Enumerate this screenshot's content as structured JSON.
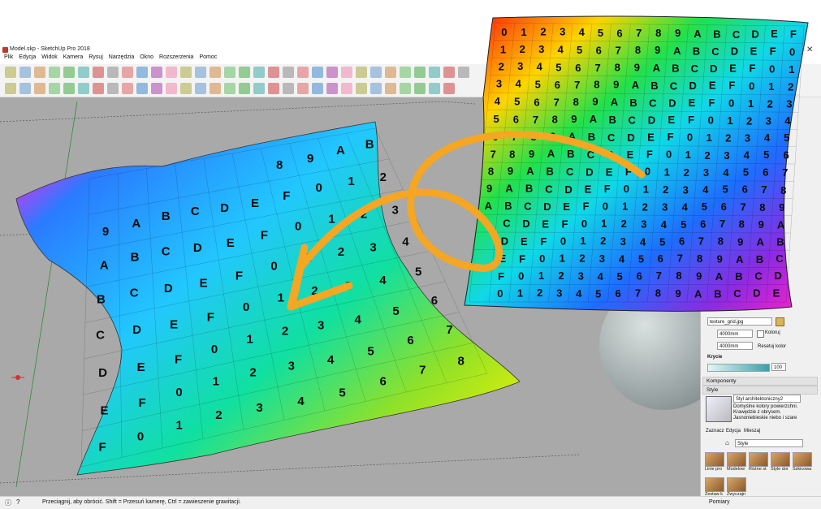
{
  "window": {
    "title": "Model.skp - SketchUp Pro 2018"
  },
  "menu": [
    "Plik",
    "Edycja",
    "Widok",
    "Kamera",
    "Rysuj",
    "Narzędzia",
    "Okno",
    "Rozszerzenia",
    "Pomoc"
  ],
  "texture_sheet": {
    "rows": [
      "0123456789ABCDEF",
      "123456789ABCDEF0",
      "23456789ABCDEF01",
      "3456789ABCDEF012",
      "456789ABCDEF0123",
      "56789ABCDEF01234",
      "6789ABCDEF012345",
      "789ABCDEF0123456",
      "89ABCDEF01234567",
      "9ABCDEF012345678",
      "ABCDEF0123456789",
      "CDEF0123456789A",
      "DEF0123456789AB",
      "EF0123456789ABC",
      "F0123456789ABCD",
      "0123456789ABCDE"
    ]
  },
  "pillow": {
    "rows": [
      "89AB",
      "9ABCDEF012",
      "ABCDEF0123",
      "BCDEF01234",
      "CDEF012345",
      "DEF0123456",
      "EF01234567",
      "F012345678"
    ]
  },
  "tray": {
    "materials": {
      "texture_file": "texture_grid.jpg",
      "width": "4000mm",
      "height": "4000mm",
      "colorize_label": "Koloruj",
      "reset_color_label": "Resetuj kolor",
      "opacity_label": "Krycie",
      "opacity_value": "100"
    },
    "components_header": "Komponenty",
    "styles_header": "Style",
    "style_name": "Styl architektoniczny2",
    "style_description": "Domyślne kolory powierzchni. Krawędzie z obrysem. Jasnoniebieskie niebo i szare",
    "tabs": [
      "Zaznacz",
      "Edycja",
      "Mieszaj"
    ],
    "style_dropdown": "Style",
    "style_thumbnails": [
      "Linie pro",
      "Modelow",
      "Różne st",
      "Style dor",
      "Szkicowa",
      "Zestaw k",
      "Zwyczajn"
    ],
    "measurements_label": "Pomiary"
  },
  "status": {
    "hint": "Przeciągnij, aby obrócić. Shift = Przesuń kamerę, Ctrl = zawieszenie grawitacji."
  },
  "colors": {
    "arrow": "#f5a623",
    "viewport_bg": "#a9a9a9"
  },
  "icons": [
    "close-icon",
    "gear-icon",
    "paint-bucket-icon",
    "eyedropper-icon",
    "home-icon",
    "info-icon",
    "help-icon"
  ]
}
